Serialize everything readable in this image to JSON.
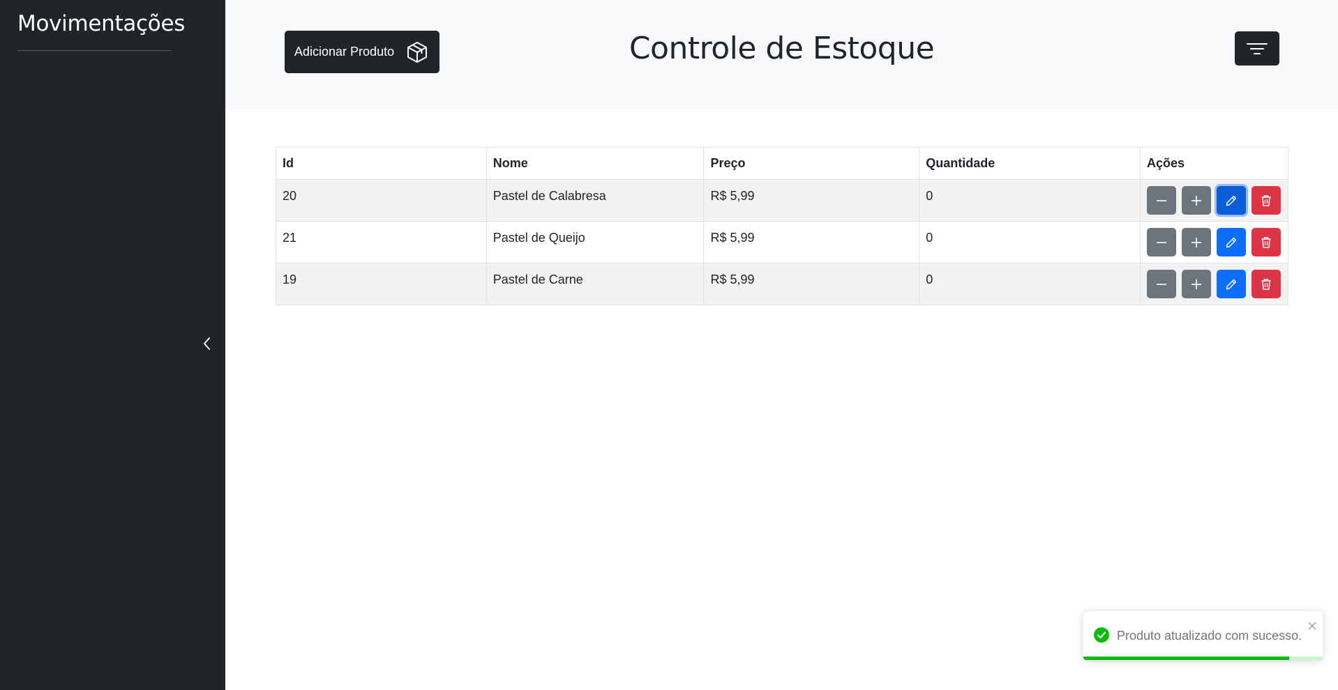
{
  "sidebar": {
    "title": "Movimentações"
  },
  "header": {
    "add_button_label": "Adicionar Produto",
    "title": "Controle de Estoque"
  },
  "table": {
    "headers": [
      "Id",
      "Nome",
      "Preço",
      "Quantidade",
      "Ações"
    ],
    "rows": [
      {
        "id": "20",
        "nome": "Pastel de Calabresa",
        "preco": "R$ 5,99",
        "quantidade": "0"
      },
      {
        "id": "21",
        "nome": "Pastel de Queijo",
        "preco": "R$ 5,99",
        "quantidade": "0"
      },
      {
        "id": "19",
        "nome": "Pastel de Carne",
        "preco": "R$ 5,99",
        "quantidade": "0"
      }
    ]
  },
  "toast": {
    "message": "Produto atualizado com sucesso.",
    "progress": 0.86
  },
  "icons": {
    "add_product": "box-icon",
    "filter": "filter-lines-icon",
    "collapse": "chevron-left-icon",
    "decrease": "minus-icon",
    "increase": "plus-icon",
    "edit": "pencil-icon",
    "delete": "trash-icon",
    "success": "check-circle-icon",
    "close": "close-icon"
  },
  "colors": {
    "sidebar_bg": "#212529",
    "header_bg": "#f8f9fa",
    "gray_button": "#6c757d",
    "edit_button": "#0d6efd",
    "delete_button": "#dc3545",
    "toast_success": "#07bc0c"
  }
}
